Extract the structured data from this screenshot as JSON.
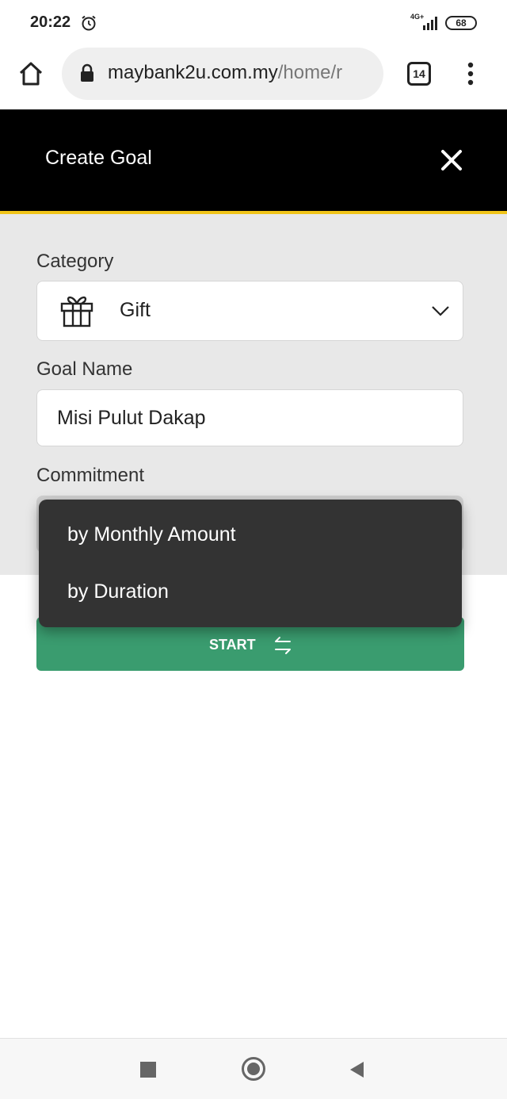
{
  "status_bar": {
    "time": "20:22",
    "network": "4G+",
    "battery": "68"
  },
  "browser": {
    "url_host": "maybank2u.com.my",
    "url_path": "/home/r",
    "tab_count": "14"
  },
  "header": {
    "title": "Create Goal"
  },
  "form": {
    "category_label": "Category",
    "category_value": "Gift",
    "goal_name_label": "Goal Name",
    "goal_name_value": "Misi Pulut Dakap",
    "commitment_label": "Commitment"
  },
  "dropdown": {
    "options": [
      "by Monthly Amount",
      "by Duration"
    ]
  },
  "start_button": {
    "label": "START"
  },
  "colors": {
    "header_bg": "#000000",
    "accent_gold": "#f0c419",
    "start_green": "#3a9c6f",
    "dropdown_bg": "#333333",
    "form_bg": "#e8e8e8"
  },
  "icons": [
    "alarm-icon",
    "signal-icon",
    "home-icon",
    "lock-icon",
    "menu-icon",
    "close-icon",
    "gift-icon",
    "chevron-down-icon",
    "swap-icon"
  ]
}
